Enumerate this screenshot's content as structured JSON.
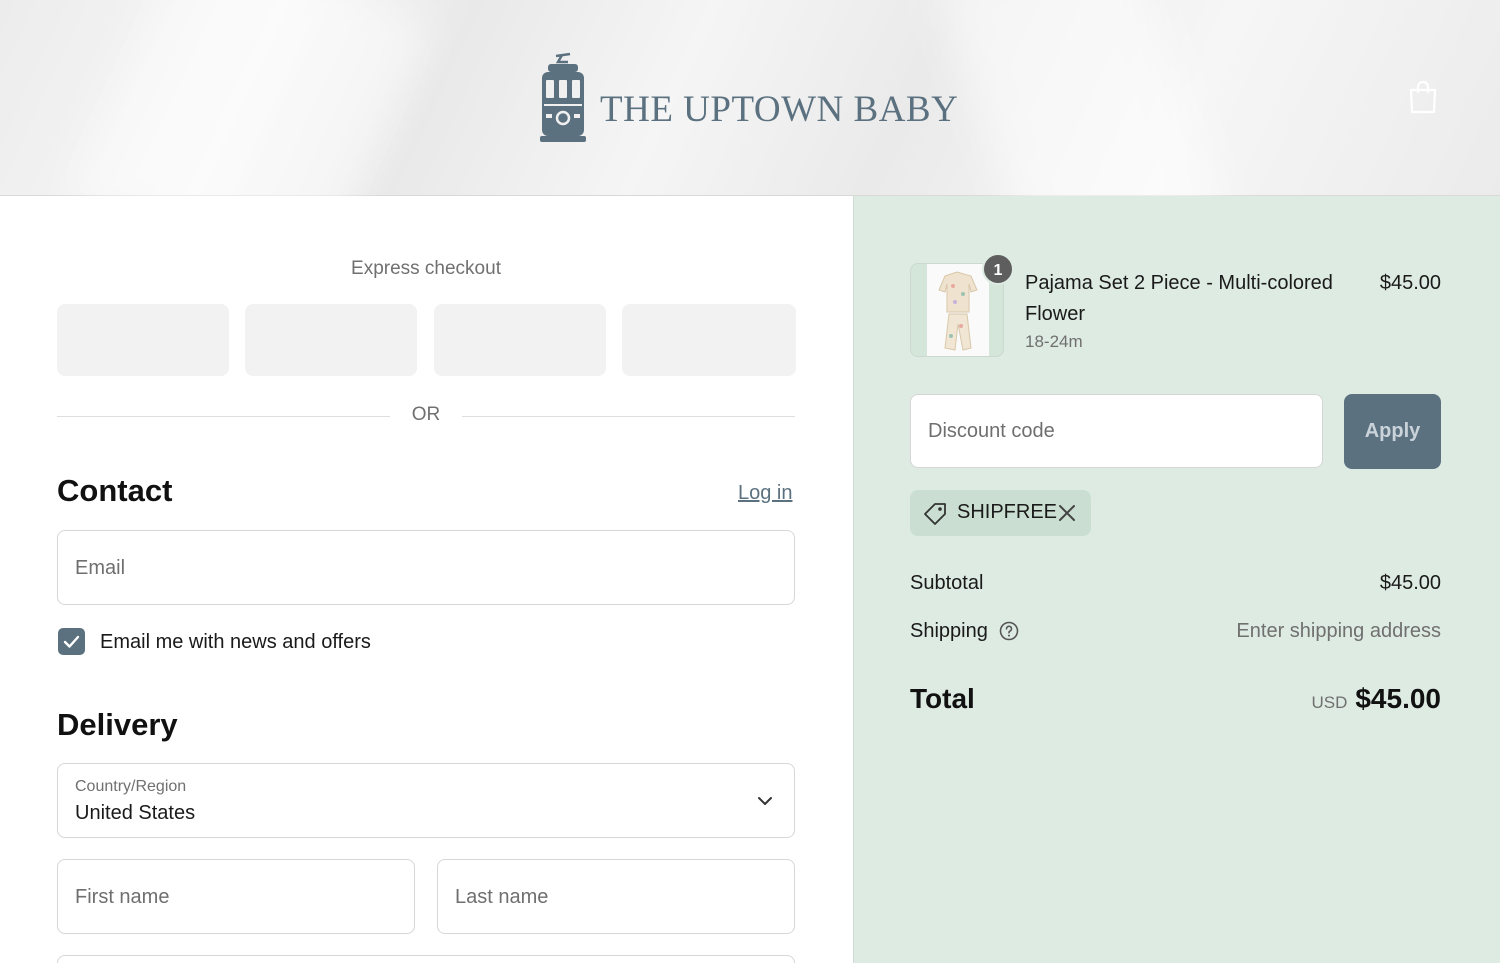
{
  "header": {
    "brand": "THE UPTOWN BABY"
  },
  "express": {
    "title": "Express checkout",
    "or_label": "OR"
  },
  "contact": {
    "title": "Contact",
    "login_label": "Log in",
    "email_placeholder": "Email",
    "newsletter_label": "Email me with news and offers",
    "newsletter_checked": true
  },
  "delivery": {
    "title": "Delivery",
    "country_label": "Country/Region",
    "country_value": "United States",
    "first_name_placeholder": "First name",
    "last_name_placeholder": "Last name"
  },
  "summary": {
    "item": {
      "name": "Pajama Set 2 Piece - Multi-colored Flower",
      "variant": "18-24m",
      "price": "$45.00",
      "quantity": "1"
    },
    "discount_placeholder": "Discount code",
    "apply_label": "Apply",
    "applied_code": "SHIPFREE",
    "subtotal_label": "Subtotal",
    "subtotal_value": "$45.00",
    "shipping_label": "Shipping",
    "shipping_value": "Enter shipping address",
    "total_label": "Total",
    "currency": "USD",
    "total_value": "$45.00"
  },
  "colors": {
    "accent": "#5b7180",
    "summary_bg": "#ddebe2"
  },
  "icons": {
    "logo": "tram-icon",
    "cart": "shopping-bag-icon",
    "tag": "tag-icon",
    "remove": "close-icon",
    "help": "question-circle-icon",
    "check": "checkmark-icon",
    "dropdown": "chevron-down-icon"
  }
}
